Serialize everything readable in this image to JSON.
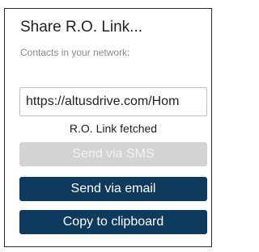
{
  "dialog": {
    "title": "Share R.O. Link...",
    "subtitle": "Contacts in your network:",
    "link_value": "https://altusdrive.com/Hom",
    "status_text": "R.O. Link fetched",
    "buttons": {
      "sms_label": "Send via SMS",
      "email_label": "Send via email",
      "copy_label": "Copy to clipboard"
    }
  },
  "colors": {
    "primary": "#0e3a5e",
    "disabled": "#d3d3d3"
  }
}
